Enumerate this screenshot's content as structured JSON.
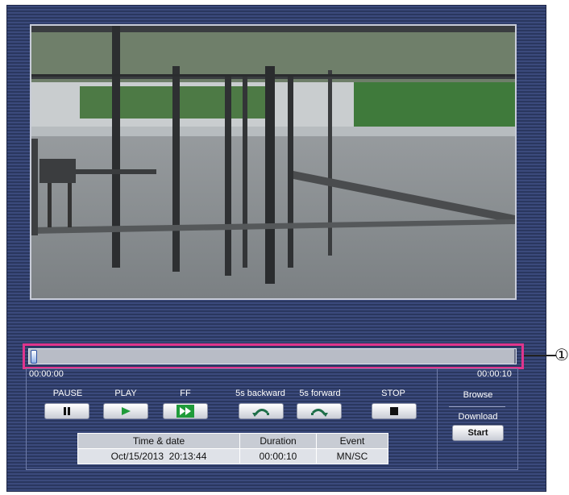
{
  "timeline": {
    "start_time": "00:00:00",
    "end_time": "00:00:10",
    "position_fraction": 0.0
  },
  "callout": {
    "number": "①"
  },
  "controls": {
    "pause": {
      "label": "PAUSE",
      "icon": "pause-icon"
    },
    "play": {
      "label": "PLAY",
      "icon": "play-icon"
    },
    "ff": {
      "label": "FF",
      "icon": "fast-forward-icon"
    },
    "back5": {
      "label": "5s backward",
      "icon": "rewind-arc-icon"
    },
    "fwd5": {
      "label": "5s forward",
      "icon": "forward-arc-icon"
    },
    "stop": {
      "label": "STOP",
      "icon": "stop-icon"
    }
  },
  "side": {
    "browse_label": "Browse",
    "download_label": "Download",
    "start_label": "Start"
  },
  "info_table": {
    "headers": [
      "Time & date",
      "Duration",
      "Event"
    ],
    "row": [
      "Oct/15/2013  20:13:44",
      "00:00:10",
      "MN/SC"
    ]
  },
  "colors": {
    "panel": "#2f3c69",
    "highlight": "#e0358d",
    "play_icon": "#1f9b3a"
  }
}
